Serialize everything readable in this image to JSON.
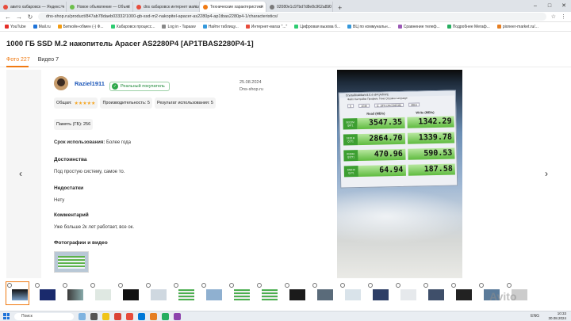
{
  "browser": {
    "tabs": [
      {
        "label": "авито хабаровск — Яндекс: н",
        "color": "#e74c3c"
      },
      {
        "label": "Новое объявление — Объяв",
        "color": "#6dbf4b"
      },
      {
        "label": "dns хабаровск интернет магаз",
        "color": "#e74c3c"
      },
      {
        "label": "Технические характеристики",
        "color": "#f07a12"
      },
      {
        "label": "02080e1c97bd7d8e8c962a810",
        "color": "#7a7a7a"
      }
    ],
    "active_tab": 3,
    "url": "dns-shop.ru/product/847ab78daeb03332/1000-gb-ssd-m2-nakopitel-apacer-as2280p4-ap1tbas2280p4-1/characteristics/",
    "bookmarks": [
      {
        "label": "YouTube",
        "color": "#e52d27"
      },
      {
        "label": "Mail.ru",
        "color": "#1e73d9"
      },
      {
        "label": "Биткойн-обмен (-) Ф...",
        "color": "#f39c12"
      },
      {
        "label": "Хабаровск процесс...",
        "color": "#2ecc71"
      },
      {
        "label": "Log in - Tapaaw",
        "color": "#888888"
      },
      {
        "label": "Найти таблицу...",
        "color": "#3498db"
      },
      {
        "label": "Интернет-магаз \"...\"",
        "color": "#e74c3c"
      },
      {
        "label": "Цифровая вызова б...",
        "color": "#2ecc71"
      },
      {
        "label": "ВЦ по коммунальн...",
        "color": "#3498db"
      },
      {
        "label": "Сравнение телеф...",
        "color": "#9b59b6"
      },
      {
        "label": "Подробнее Мегаф...",
        "color": "#27ae60"
      },
      {
        "label": "pioneer-market.ru/...",
        "color": "#e67e22"
      }
    ]
  },
  "page": {
    "title": "1000 ГБ SSD M.2 накопитель Apacer AS2280P4 [AP1TBAS2280P4-1]",
    "tab_photos": "Фото 227",
    "tab_videos": "Видео 7"
  },
  "review": {
    "username": "Raziel1911",
    "buyer_badge": "Реальный покупатель",
    "date": "25.08.2024",
    "source": "Dns-shop.ru",
    "rating_overall_label": "Общая:",
    "rating_stars": "★★★★★",
    "productivity": "Производительность: 5",
    "results": "Результат использования: 5",
    "memory": "Память (ГБ): 256",
    "usage_label": "Срок использования:",
    "usage_value": "Более года",
    "pros_h": "Достоинства",
    "pros_t": "Под простую систему, самое то.",
    "cons_h": "Недостатки",
    "cons_t": "Нету",
    "comment_h": "Комментарий",
    "comment_t": "Уже больше 2к лет работает, все ок.",
    "media_h": "Фотографии и видео"
  },
  "benchmark": {
    "title": "CrystalDiskMark 8.0.4 x64 [Admin]",
    "menu": "Файл  Настройки  Профиль  Тема  Справка  Language",
    "runs": "5",
    "size": "1GiB",
    "drive": "C: 19% (44/238GiB)",
    "unit_label": "MB/s",
    "read_header": "Read (MB/s)",
    "write_header": "Write (MB/s)",
    "rows": [
      {
        "label": "SEQ1M Q8T1",
        "read": "3547.35",
        "write": "1342.29"
      },
      {
        "label": "SEQ1M Q1T1",
        "read": "2864.70",
        "write": "1339.78"
      },
      {
        "label": "RND4K Q32T1",
        "read": "470.96",
        "write": "590.53"
      },
      {
        "label": "RND4K Q1T1",
        "read": "64.94",
        "write": "187.58"
      }
    ]
  },
  "watermark": "Avito",
  "taskbar": {
    "search": "Поиск",
    "tray": "ENG",
    "time": "10:33",
    "date": "30.08.2024"
  }
}
